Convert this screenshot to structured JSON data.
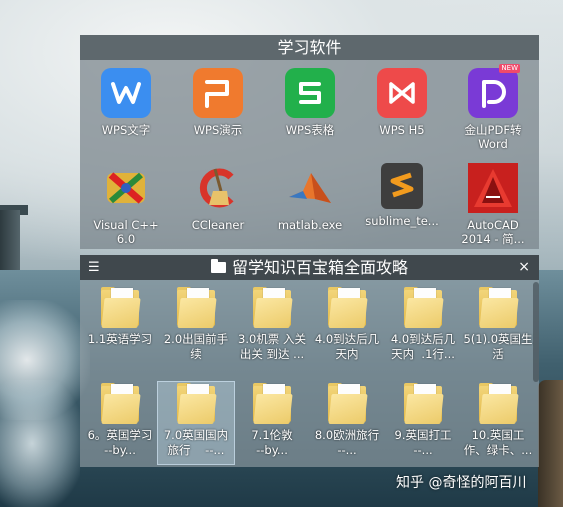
{
  "fence_software": {
    "title": "学习软件",
    "apps": [
      {
        "label": "WPS文字",
        "icon": "wps-writer-icon",
        "color": "#3b8ef0",
        "glyph": "W"
      },
      {
        "label": "WPS演示",
        "icon": "wps-presentation-icon",
        "color": "#f07a2e",
        "glyph": "P"
      },
      {
        "label": "WPS表格",
        "icon": "wps-spreadsheet-icon",
        "color": "#22b04b",
        "glyph": "S"
      },
      {
        "label": "WPS H5",
        "icon": "wps-h5-icon",
        "color": "#ee4a4a",
        "glyph": "⋈"
      },
      {
        "label": "金山PDF转\nWord",
        "icon": "kingsoft-pdf-icon",
        "color": "#7a3ad6",
        "glyph": "D"
      },
      {
        "label": "Visual C++\n6.0",
        "icon": "visual-cpp-icon",
        "color": "#e0b23a",
        "glyph": "✕"
      },
      {
        "label": "CCleaner",
        "icon": "ccleaner-icon",
        "color": "#d8342a",
        "glyph": "C"
      },
      {
        "label": "matlab.exe",
        "icon": "matlab-icon",
        "color": "#e8762c",
        "glyph": "▲"
      },
      {
        "label": "sublime_te...",
        "icon": "sublime-text-icon",
        "color": "#4a4a4a",
        "glyph": "S"
      },
      {
        "label": "AutoCAD\n2014 - 简...",
        "icon": "autocad-icon",
        "color": "#c8201e",
        "glyph": "A"
      }
    ],
    "new_badge": "NEW"
  },
  "fence_folders": {
    "title": "留学知识百宝箱全面攻略",
    "menu_glyph": "☰",
    "close_glyph": "×",
    "folders": [
      {
        "label": "1.1英语学习"
      },
      {
        "label": "2.0出国前手\n续"
      },
      {
        "label": "3.0机票 入关\n出关 到达 ..."
      },
      {
        "label": "4.0到达后几\n天内"
      },
      {
        "label": "4.0到达后几\n天内  .1行..."
      },
      {
        "label": "5(1).0英国生\n活"
      },
      {
        "label": "6。英国学习\n--by..."
      },
      {
        "label": "7.0英国国内\n旅行    --..."
      },
      {
        "label": "7.1伦敦\n--by..."
      },
      {
        "label": "8.0欧洲旅行\n--..."
      },
      {
        "label": "9.英国打工\n--..."
      },
      {
        "label": "10.英国工\n作、绿卡、..."
      }
    ],
    "selected_index": 7
  },
  "watermark": "知乎 @奇怪的阿百川"
}
